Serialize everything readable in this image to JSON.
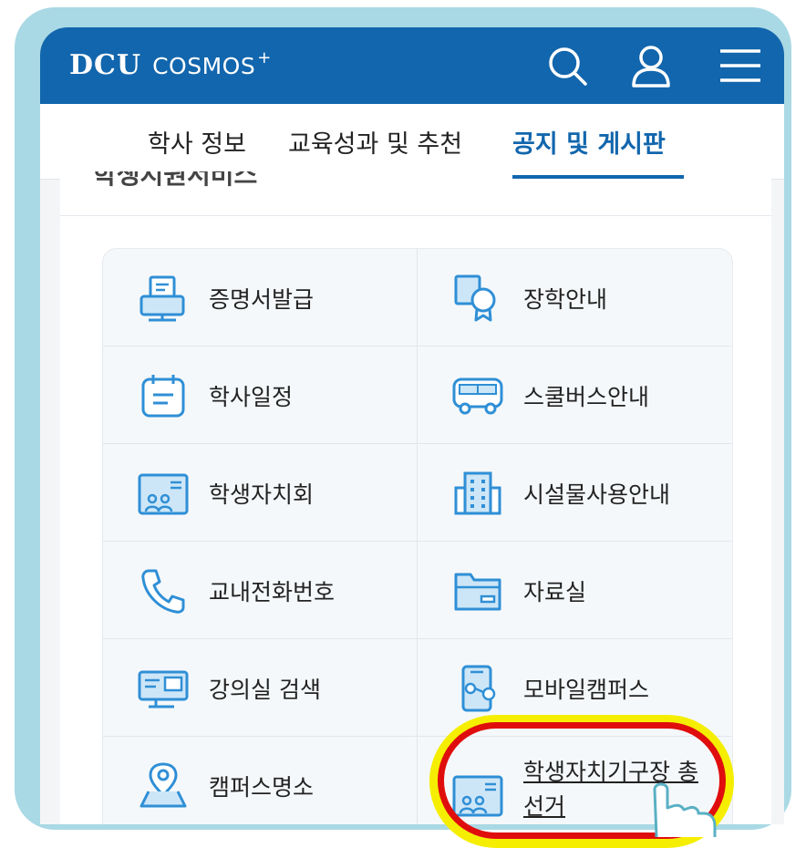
{
  "header": {
    "logo_main": "DCU",
    "logo_sub": "COSMOS",
    "logo_plus": "+",
    "icons": [
      "search-icon",
      "user-icon",
      "menu-icon"
    ],
    "color": "#1266ad"
  },
  "nav": {
    "tabs": [
      {
        "label": "학사 정보",
        "active": false
      },
      {
        "label": "교육성과 및 추천",
        "active": false
      },
      {
        "label": "공지 및 게시판",
        "active": true
      }
    ]
  },
  "section": {
    "title_partial": "학생지원서비스"
  },
  "services": [
    {
      "label": "증명서발급",
      "icon": "certificate-printer-icon"
    },
    {
      "label": "장학안내",
      "icon": "scholarship-medal-icon"
    },
    {
      "label": "학사일정",
      "icon": "calendar-icon"
    },
    {
      "label": "스쿨버스안내",
      "icon": "bus-icon"
    },
    {
      "label": "학생자치회",
      "icon": "student-council-icon"
    },
    {
      "label": "시설물사용안내",
      "icon": "building-icon"
    },
    {
      "label": "교내전화번호",
      "icon": "phone-icon"
    },
    {
      "label": "자료실",
      "icon": "folder-icon"
    },
    {
      "label": "강의실 검색",
      "icon": "classroom-icon"
    },
    {
      "label": "모바일캠퍼스",
      "icon": "mobile-icon"
    },
    {
      "label": "캠퍼스명소",
      "icon": "map-pin-icon"
    },
    {
      "label": "학생자치기구장 총선거",
      "icon": "election-icon"
    }
  ],
  "highlight": {
    "outer_color": "#f5ee00",
    "inner_color": "#e00d0d"
  }
}
